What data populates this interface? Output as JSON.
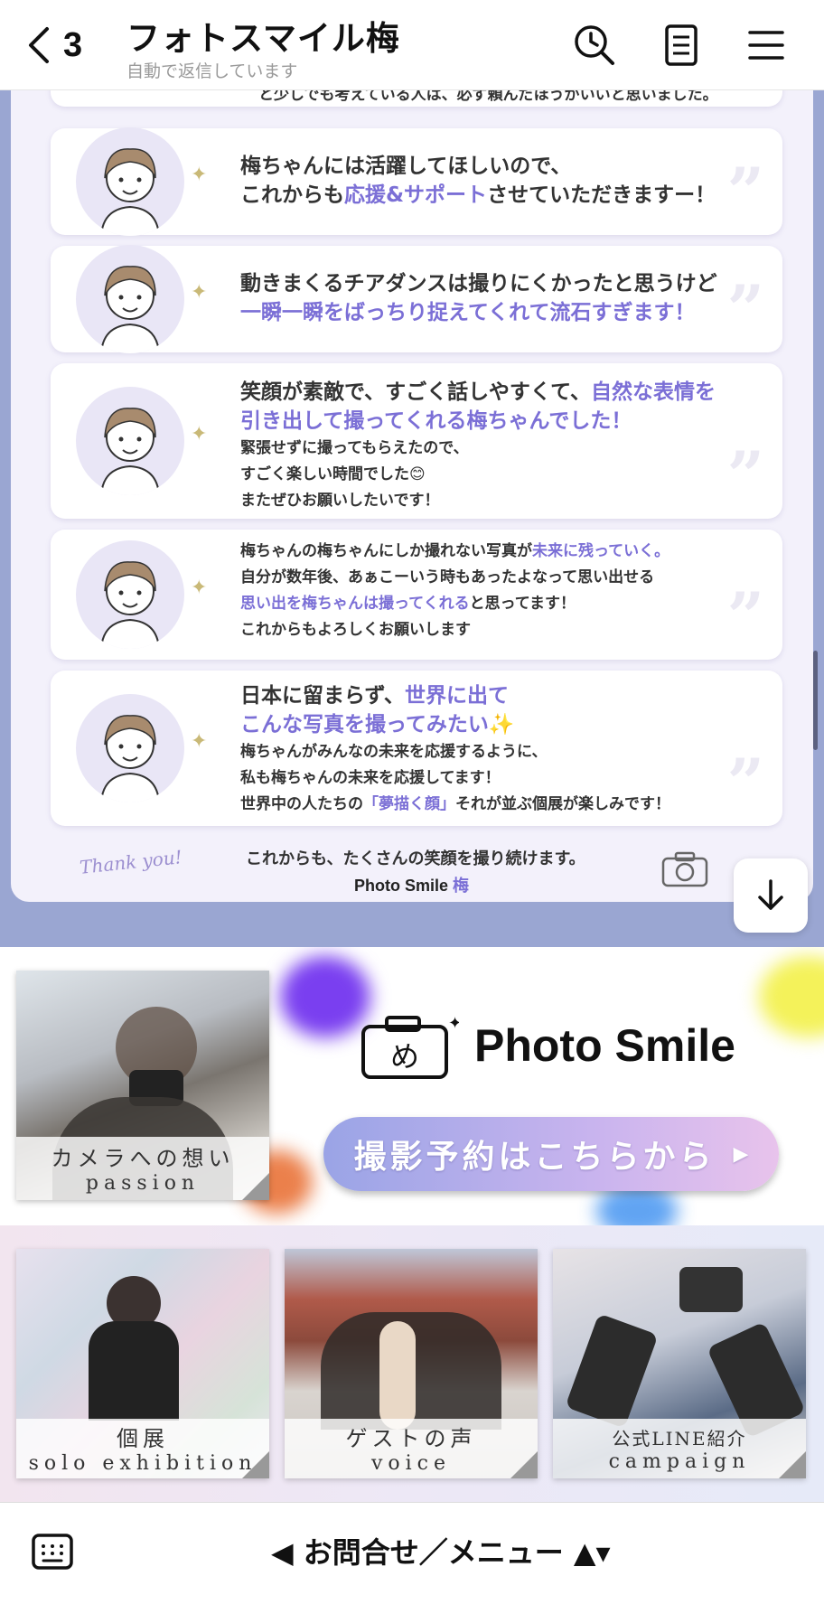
{
  "header": {
    "back_count": "3",
    "title": "フォトスマイル梅",
    "subtitle": "自動で返信しています",
    "icons": [
      "back-chevron-icon",
      "search-clock-icon",
      "note-icon",
      "hamburger-menu-icon"
    ]
  },
  "chat": {
    "top_line": "と少しでも考えている人は、必ず頼んだほうがいいと思いました。",
    "testimonials": [
      {
        "lines": [
          {
            "size": "l",
            "parts": [
              {
                "t": "梅ちゃんには活躍してほしいので、",
                "a": false
              }
            ]
          },
          {
            "size": "l",
            "parts": [
              {
                "t": "これからも",
                "a": false
              },
              {
                "t": "応援&サポート",
                "a": true
              },
              {
                "t": "させていただきますー！",
                "a": false
              }
            ]
          }
        ]
      },
      {
        "lines": [
          {
            "size": "l",
            "parts": [
              {
                "t": "動きまくるチアダンスは撮りにくかったと思うけど",
                "a": false
              }
            ]
          },
          {
            "size": "l",
            "parts": [
              {
                "t": "一瞬一瞬をばっちり捉えてくれて流石すぎます！",
                "a": true
              }
            ]
          }
        ]
      },
      {
        "lines": [
          {
            "size": "l",
            "parts": [
              {
                "t": "笑顔が素敵で、すごく話しやすくて、",
                "a": false
              },
              {
                "t": "自然な表情を",
                "a": true
              }
            ]
          },
          {
            "size": "l",
            "parts": [
              {
                "t": "引き出して撮ってくれる梅ちゃんでした！",
                "a": true
              }
            ]
          },
          {
            "size": "s",
            "parts": [
              {
                "t": "緊張せずに撮ってもらえたので、",
                "a": false
              }
            ]
          },
          {
            "size": "s",
            "parts": [
              {
                "t": "すごく楽しい時間でした😊",
                "a": false
              }
            ]
          },
          {
            "size": "s",
            "parts": [
              {
                "t": "またぜひお願いしたいです！",
                "a": false
              }
            ]
          }
        ]
      },
      {
        "lines": [
          {
            "size": "s",
            "parts": [
              {
                "t": "梅ちゃんの梅ちゃんにしか撮れない写真が",
                "a": false
              },
              {
                "t": "未来に残っていく。",
                "a": true
              }
            ]
          },
          {
            "size": "s",
            "parts": [
              {
                "t": "自分が数年後、あぁこーいう時もあったよなって思い出せる",
                "a": false
              }
            ]
          },
          {
            "size": "s",
            "parts": [
              {
                "t": "思い出を梅ちゃんは撮ってくれる",
                "a": true
              },
              {
                "t": "と思ってます！",
                "a": false
              }
            ]
          },
          {
            "size": "s",
            "parts": [
              {
                "t": "これからもよろしくお願いします",
                "a": false
              }
            ]
          }
        ]
      },
      {
        "lines": [
          {
            "size": "l",
            "parts": [
              {
                "t": "日本に留まらず、",
                "a": false
              },
              {
                "t": "世界に出て",
                "a": true
              }
            ]
          },
          {
            "size": "l",
            "parts": [
              {
                "t": "こんな写真を撮ってみたい✨",
                "a": true
              }
            ]
          },
          {
            "size": "s",
            "parts": [
              {
                "t": "梅ちゃんがみんなの未来を応援するように、",
                "a": false
              }
            ]
          },
          {
            "size": "s",
            "parts": [
              {
                "t": "私も梅ちゃんの未来を応援してます！",
                "a": false
              }
            ]
          },
          {
            "size": "s",
            "parts": [
              {
                "t": "世界中の人たちの",
                "a": false
              },
              {
                "t": "「夢描く顔」",
                "a": true
              },
              {
                "t": "それが並ぶ個展が楽しみです！",
                "a": false
              }
            ]
          }
        ]
      }
    ],
    "thanks_script": "Thank you!",
    "footer_line": "これからも、たくさんの笑顔を撮り続けます。",
    "footer_brand": "Photo Smile",
    "footer_brand_accent": "梅",
    "scroll_down_icon": "arrow-down-icon"
  },
  "rich_menu": {
    "passion": {
      "label_jp": "カメラへの想い",
      "label_en": "passion"
    },
    "logo_text": "Photo Smile",
    "reserve_label": "撮影予約はこちらから",
    "reserve_arrow": "▶",
    "tiles": [
      {
        "label_jp": "個展",
        "label_en": "solo exhibition"
      },
      {
        "label_jp": "ゲストの声",
        "label_en": "voice"
      },
      {
        "label_jp": "公式LINE紹介",
        "label_en": "campaign"
      }
    ]
  },
  "bottom_bar": {
    "menu_label": "◀ お問合せ／メニュー ▲▾",
    "keyboard_icon": "keyboard-icon"
  },
  "colors": {
    "chat_bg": "#9aa6d2",
    "accent_purple": "#7b6fd6",
    "button_gradient_start": "#9aa4e6",
    "button_gradient_end": "#e8c3ec"
  }
}
